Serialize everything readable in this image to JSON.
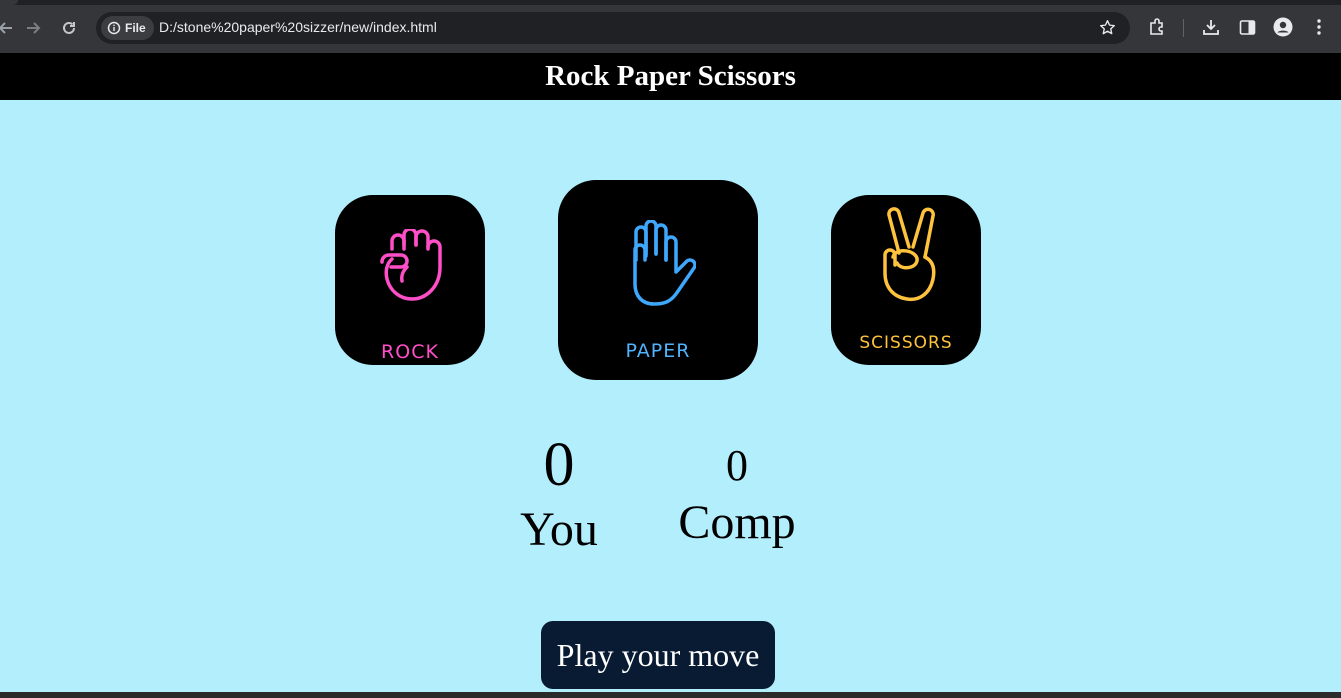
{
  "browser": {
    "chip_label": "File",
    "url": "D:/stone%20paper%20sizzer/new/index.html"
  },
  "page": {
    "title": "Rock Paper Scissors",
    "choices": [
      {
        "label": "ROCK",
        "icon": "fist-icon",
        "color": "#ff4fc8"
      },
      {
        "label": "PAPER",
        "icon": "open-hand-icon",
        "color": "#3ea8ff"
      },
      {
        "label": "SCISSORS",
        "icon": "peace-hand-icon",
        "color": "#ffc23d"
      }
    ],
    "score": {
      "user_value": "0",
      "user_label": "You",
      "comp_value": "0",
      "comp_label": "Comp"
    },
    "message": "Play your move"
  },
  "colors": {
    "background": "#b3eefc",
    "header": "#000000",
    "message_bg": "#081b33"
  }
}
